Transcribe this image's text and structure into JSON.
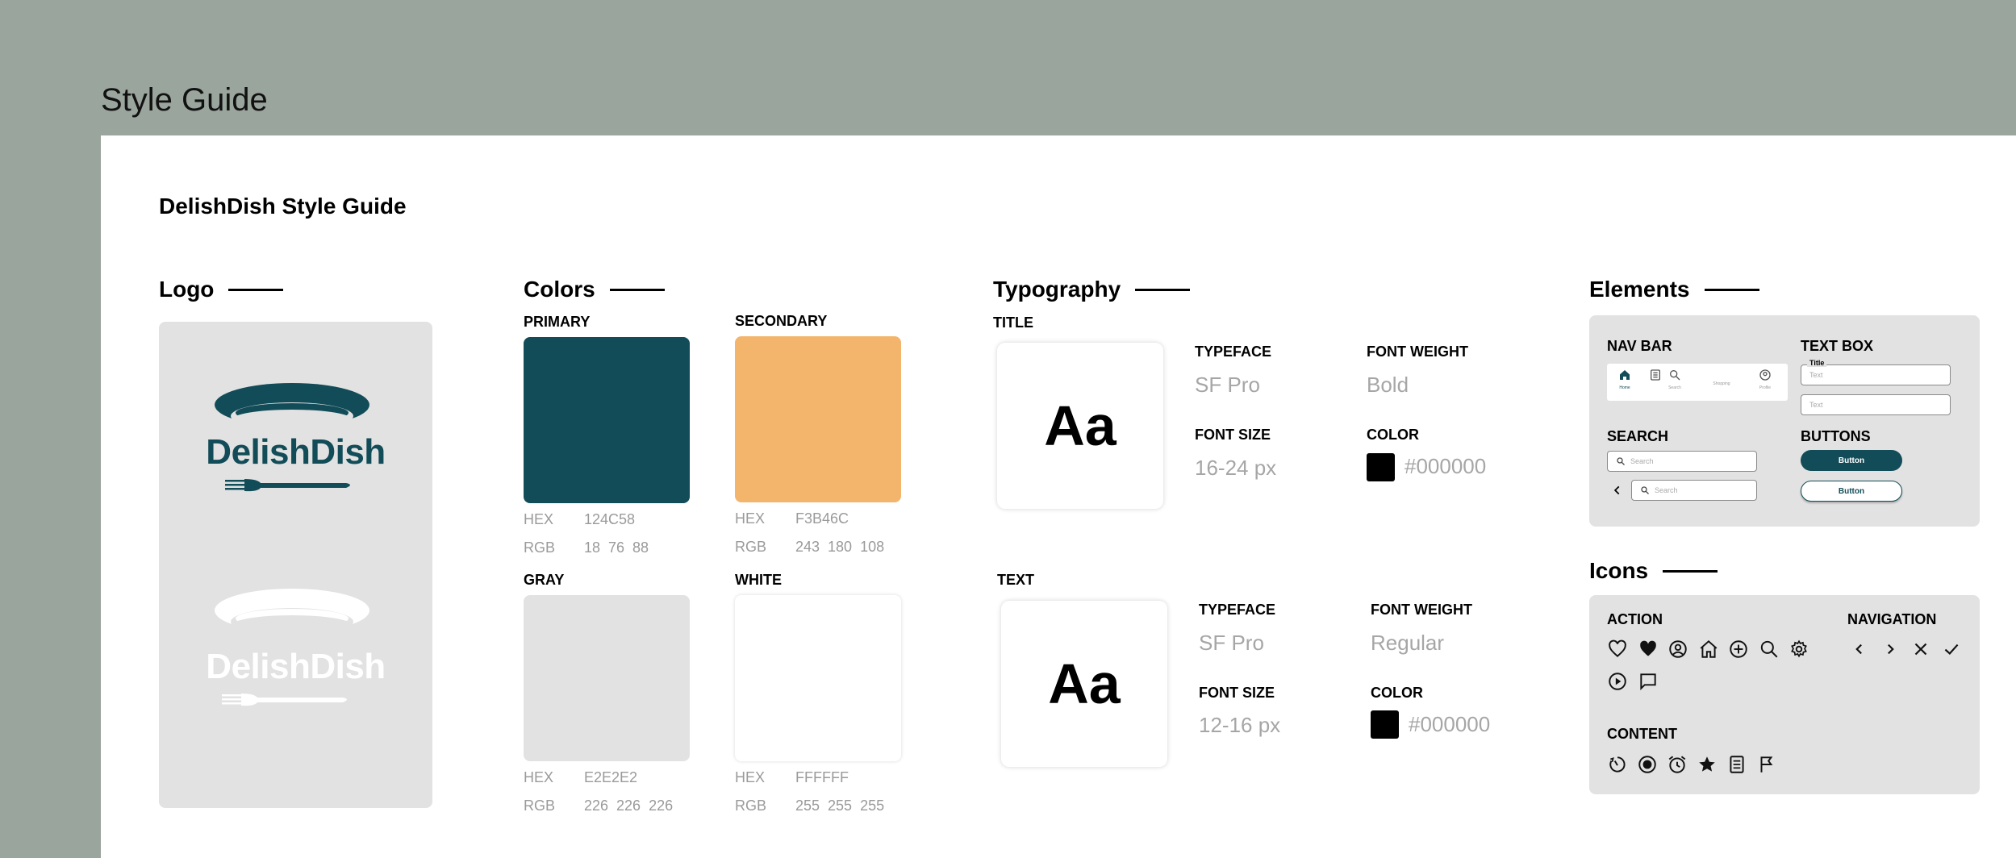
{
  "frame_title": "Style Guide",
  "guide_title": "DelishDish Style Guide",
  "logo": {
    "section_title": "Logo",
    "brand_text": "DelishDish",
    "brand_text_light": "DelishDish"
  },
  "colors": {
    "section_title": "Colors",
    "swatches": [
      {
        "label": "PRIMARY",
        "hex_label": "HEX",
        "hex": "124C58",
        "rgb_label": "RGB",
        "rgb": "18  76  88",
        "color": "#124C58"
      },
      {
        "label": "SECONDARY",
        "hex_label": "HEX",
        "hex": "F3B46C",
        "rgb_label": "RGB",
        "rgb": "243  180  108",
        "color": "#F3B46C"
      },
      {
        "label": "GRAY",
        "hex_label": "HEX",
        "hex": "E2E2E2",
        "rgb_label": "RGB",
        "rgb": "226  226  226",
        "color": "#E2E2E2"
      },
      {
        "label": "WHITE",
        "hex_label": "HEX",
        "hex": "FFFFFF",
        "rgb_label": "RGB",
        "rgb": "255  255  255",
        "color": "#FFFFFF"
      }
    ]
  },
  "typography": {
    "section_title": "Typography",
    "styles": [
      {
        "label": "TITLE",
        "sample": "Aa",
        "typeface_head": "TYPEFACE",
        "typeface": "SF Pro",
        "weight_head": "FONT WEIGHT",
        "weight": "Bold",
        "size_head": "FONT SIZE",
        "size": "16-24 px",
        "color_head": "COLOR",
        "color": "#000000"
      },
      {
        "label": "TEXT",
        "sample": "Aa",
        "typeface_head": "TYPEFACE",
        "typeface": "SF Pro",
        "weight_head": "FONT WEIGHT",
        "weight": "Regular",
        "size_head": "FONT SIZE",
        "size": "12-16 px",
        "color_head": "COLOR",
        "color": "#000000"
      }
    ]
  },
  "elements": {
    "section_title": "Elements",
    "nav_bar": {
      "label": "NAV BAR",
      "items": [
        "Home",
        "",
        "Search",
        "Shopping",
        "Profile"
      ]
    },
    "text_box": {
      "label": "TEXT BOX",
      "field_title": "Title",
      "placeholder_1": "Text",
      "placeholder_2": "Text"
    },
    "search": {
      "label": "SEARCH",
      "placeholder_1": "Search",
      "placeholder_2": "Search"
    },
    "buttons": {
      "label": "BUTTONS",
      "filled": "Button",
      "outline": "Button"
    }
  },
  "icons": {
    "section_title": "Icons",
    "action_label": "ACTION",
    "navigation_label": "NAVIGATION",
    "content_label": "CONTENT",
    "action_icons": [
      "heart-outline-icon",
      "heart-filled-icon",
      "user-circle-icon",
      "home-icon",
      "plus-circle-icon",
      "search-icon",
      "gear-icon",
      "play-circle-icon",
      "chat-icon"
    ],
    "navigation_icons": [
      "chevron-left-icon",
      "chevron-right-icon",
      "close-icon",
      "check-icon"
    ],
    "content_icons": [
      "timer-icon",
      "record-icon",
      "alarm-icon",
      "star-icon",
      "list-icon",
      "flag-icon"
    ]
  },
  "brand_colors": {
    "primary": "#124C58",
    "secondary": "#F3B46C",
    "gray": "#E2E2E2",
    "white": "#FFFFFF",
    "frame_bg": "#9AA59D"
  }
}
